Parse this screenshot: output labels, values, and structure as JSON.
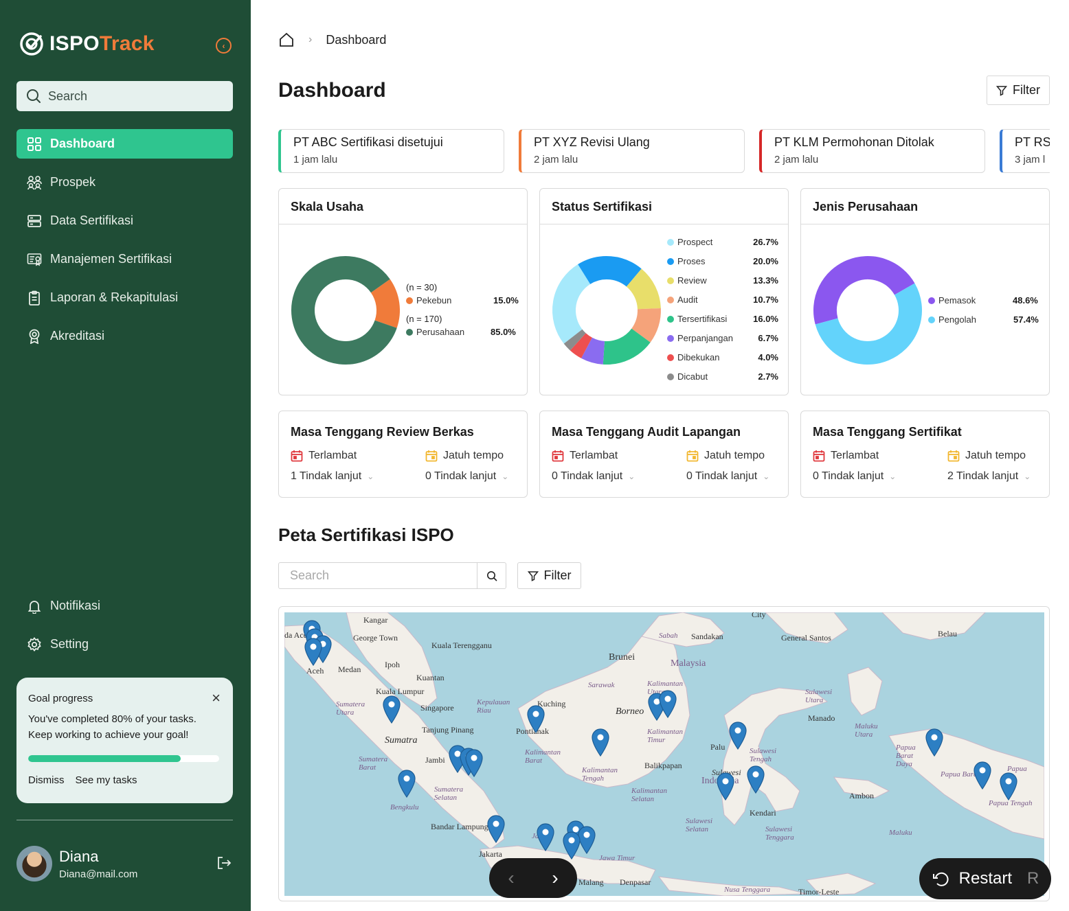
{
  "app": {
    "brand_left": "ISPO",
    "brand_right": "Track",
    "accent": "#2fc58f",
    "brand_orange": "#f07b3a",
    "sidebar_bg": "#1f4d36"
  },
  "sidebar": {
    "search_placeholder": "Search",
    "items": [
      {
        "label": "Dashboard",
        "icon": "grid-icon",
        "active": true
      },
      {
        "label": "Prospek",
        "icon": "users-icon"
      },
      {
        "label": "Data Sertifikasi",
        "icon": "server-icon"
      },
      {
        "label": "Manajemen Sertifikasi",
        "icon": "certificate-icon"
      },
      {
        "label": "Laporan & Rekapitulasi",
        "icon": "clipboard-icon"
      },
      {
        "label": "Akreditasi",
        "icon": "award-icon"
      }
    ],
    "bottom_items": [
      {
        "label": "Notifikasi",
        "icon": "bell-icon"
      },
      {
        "label": "Setting",
        "icon": "gear-icon"
      }
    ],
    "goal": {
      "title": "Goal progress",
      "text": "You've completed 80% of your tasks. Keep working to achieve your goal!",
      "progress": 0.8,
      "dismiss": "Dismiss",
      "see_tasks": "See my tasks"
    },
    "user": {
      "name": "Diana",
      "email": "Diana@mail.com"
    }
  },
  "header": {
    "breadcrumb": "Dashboard",
    "title": "Dashboard",
    "filter": "Filter"
  },
  "notices": [
    {
      "title": "PT ABC Sertifikasi disetujui",
      "time": "1 jam lalu",
      "color": "#2fc58f"
    },
    {
      "title": "PT XYZ Revisi Ulang",
      "time": "2 jam lalu",
      "color": "#f07b3a"
    },
    {
      "title": "PT KLM Permohonan Ditolak",
      "time": "2 jam lalu",
      "color": "#d62828"
    },
    {
      "title": "PT RST",
      "time": "3 jam l",
      "color": "#3a7bd5"
    }
  ],
  "charts": {
    "skala": {
      "title": "Skala Usaha",
      "legend": [
        {
          "n": "(n = 30)",
          "label": "Pekebun",
          "pct": "15.0%",
          "color": "#f07b3a"
        },
        {
          "n": "(n = 170)",
          "label": "Perusahaan",
          "pct": "85.0%",
          "color": "#3d7a60"
        }
      ]
    },
    "status": {
      "title": "Status Sertifikasi",
      "legend": [
        {
          "label": "Prospect",
          "pct": "26.7%",
          "color": "#a6e9fb"
        },
        {
          "label": "Proses",
          "pct": "20.0%",
          "color": "#1a9bf2"
        },
        {
          "label": "Review",
          "pct": "13.3%",
          "color": "#e8de6a"
        },
        {
          "label": "Audit",
          "pct": "10.7%",
          "color": "#f5a37a"
        },
        {
          "label": "Tersertifikasi",
          "pct": "16.0%",
          "color": "#2ec38a"
        },
        {
          "label": "Perpanjangan",
          "pct": "6.7%",
          "color": "#8a6cf0"
        },
        {
          "label": "Dibekukan",
          "pct": "4.0%",
          "color": "#ee4f4f"
        },
        {
          "label": "Dicabut",
          "pct": "2.7%",
          "color": "#8c8c8c"
        }
      ]
    },
    "jenis": {
      "title": "Jenis Perusahaan",
      "legend": [
        {
          "label": "Pemasok",
          "pct": "48.6%",
          "color": "#8b57ef"
        },
        {
          "label": "Pengolah",
          "pct": "57.4%",
          "color": "#63d3fb"
        }
      ]
    }
  },
  "chart_data": [
    {
      "type": "pie",
      "title": "Skala Usaha",
      "categories": [
        "Pekebun",
        "Perusahaan"
      ],
      "values": [
        15.0,
        85.0
      ],
      "counts": [
        30,
        170
      ]
    },
    {
      "type": "pie",
      "title": "Status Sertifikasi",
      "categories": [
        "Prospect",
        "Proses",
        "Review",
        "Audit",
        "Tersertifikasi",
        "Perpanjangan",
        "Dibekukan",
        "Dicabut"
      ],
      "values": [
        26.7,
        20.0,
        13.3,
        10.7,
        16.0,
        6.7,
        4.0,
        2.7
      ]
    },
    {
      "type": "pie",
      "title": "Jenis Perusahaan",
      "categories": [
        "Pemasok",
        "Pengolah"
      ],
      "values": [
        48.6,
        57.4
      ]
    }
  ],
  "masa": [
    {
      "title": "Masa Tenggang Review Berkas",
      "late_label": "Terlambat",
      "late_value": "1 Tindak lanjut",
      "due_label": "Jatuh tempo",
      "due_value": "0 Tindak lanjut"
    },
    {
      "title": "Masa Tenggang Audit Lapangan",
      "late_label": "Terlambat",
      "late_value": "0 Tindak lanjut",
      "due_label": "Jatuh tempo",
      "due_value": "0 Tindak lanjut"
    },
    {
      "title": "Masa Tenggang Sertifikat",
      "late_label": "Terlambat",
      "late_value": "0 Tindak lanjut",
      "due_label": "Jatuh tempo",
      "due_value": "2 Tindak lanjut"
    }
  ],
  "map_section": {
    "title": "Peta Sertifikasi ISPO",
    "search_placeholder": "Search",
    "filter": "Filter",
    "labels": {
      "kangar": "Kangar",
      "george": "George Town",
      "kuala_t": "Kuala Terengganu",
      "ipoh": "Ipoh",
      "medan": "Medan",
      "kuantan": "Kuantan",
      "kl": "Kuala Lumpur",
      "singapore": "Singapore",
      "tanjung": "Tanjung Pinang",
      "sumatra": "Sumatra",
      "sumut": "Sumatera Utara",
      "sumbar": "Sumatera Barat",
      "jambi": "Jambi",
      "bengkulu": "Bengkulu",
      "sumsel": "Sumatera Selatan",
      "bandar": "Bandar Lampung",
      "jakarta": "Jakarta",
      "kuching": "Kuching",
      "pontianak": "Pontianak",
      "kepri": "Kepulauan Riau",
      "brunei": "Brunei",
      "sandakan": "Sandakan",
      "sabah": "Sabah",
      "malaysia": "Malaysia",
      "sarawak": "Sarawak",
      "borneo": "Borneo",
      "kaltara": "Kalimantan Utara",
      "kaltim": "Kalimantan Timur",
      "kalbar": "Kalimantan Barat",
      "kalteng": "Kalimantan Tengah",
      "kalsel": "Kalimantan Selatan",
      "balikpapan": "Balikpapan",
      "palu": "Palu",
      "sulteng": "Sulawesi Tengah",
      "sulawesi": "Sulawesi",
      "indonesia": "Indonesia",
      "sulsel": "Sulawesi Selatan",
      "sultra": "Sulawesi Tenggara",
      "kendari": "Kendari",
      "manado": "Manado",
      "sulut": "Sulawesi Utara",
      "general": "General Santos",
      "belau": "Belau",
      "malukuu": "Maluku Utara",
      "maluku": "Maluku",
      "ambon": "Ambon",
      "papuabd": "Papua Barat Daya",
      "papuab": "Papua Barat",
      "papua": "Papua",
      "papuat": "Papua Tengah",
      "jawa": "Jawa",
      "jatim": "Jawa Timur",
      "malang": "Malang",
      "denpasar": "Denpasar",
      "ntt": "Nusa Tenggara",
      "timor": "Timor-Leste",
      "aceh": "Aceh",
      "da_aceh": "da Aceh",
      "city": "City"
    }
  },
  "controls": {
    "prev": "‹",
    "next": "›",
    "restart": "Restart",
    "restart_key": "R"
  }
}
